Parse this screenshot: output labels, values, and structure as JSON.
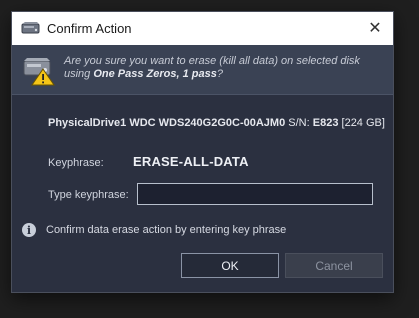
{
  "window": {
    "title": "Confirm Action",
    "close_glyph": "✕"
  },
  "warning": {
    "prefix": "Are you sure you want to erase (kill all data) on selected disk using ",
    "method": "One Pass Zeros, 1 pass",
    "suffix": "?"
  },
  "drive": {
    "name": "PhysicalDrive1 WDC WDS240G2G0C-00AJM0",
    "serial_label": "S/N:",
    "serial": "E823",
    "size": "[224 GB]"
  },
  "keyphrase": {
    "label": "Keyphrase:",
    "value": "ERASE-ALL-DATA"
  },
  "type_keyphrase": {
    "label": "Type keyphrase:",
    "value": "",
    "placeholder": ""
  },
  "info": {
    "icon": "info-icon",
    "text": "Confirm data erase action by entering key phrase"
  },
  "buttons": {
    "ok_label": "OK",
    "cancel_label": "Cancel"
  },
  "colors": {
    "dialog_bg": "#2b3040",
    "banner_bg": "#3a4254",
    "warning_yellow": "#f5c518"
  }
}
